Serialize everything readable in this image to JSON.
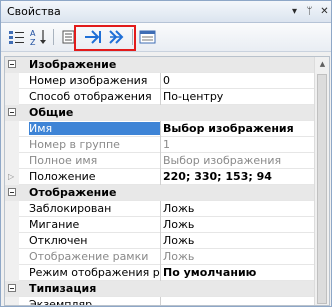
{
  "window": {
    "title": "Свойства"
  },
  "title_buttons": {
    "pin": "▾",
    "pin2": "ᛘ",
    "close": "✕"
  },
  "grid": {
    "rows": [
      {
        "kind": "category",
        "label": "Изображение"
      },
      {
        "kind": "prop",
        "name": "Номер изображения",
        "value": "0"
      },
      {
        "kind": "prop",
        "name": "Способ отображения",
        "value": "По-центру"
      },
      {
        "kind": "category",
        "label": "Общие"
      },
      {
        "kind": "prop",
        "name": "Имя",
        "value": "Выбор изображения",
        "selected": true,
        "value_bold": true
      },
      {
        "kind": "prop",
        "name": "Номер в группе",
        "value": "1",
        "gray": true
      },
      {
        "kind": "prop",
        "name": "Полное имя",
        "value": "Выбор изображения",
        "gray": true
      },
      {
        "kind": "prop",
        "name": "Положение",
        "value": "220; 330; 153; 94",
        "value_bold": true,
        "expand": true
      },
      {
        "kind": "category",
        "label": "Отображение"
      },
      {
        "kind": "prop",
        "name": "Заблокирован",
        "value": "Ложь"
      },
      {
        "kind": "prop",
        "name": "Мигание",
        "value": "Ложь"
      },
      {
        "kind": "prop",
        "name": "Отключен",
        "value": "Ложь"
      },
      {
        "kind": "prop",
        "name": "Отображение рамки",
        "value": "Ложь",
        "gray": true
      },
      {
        "kind": "prop",
        "name": "Режим отображения ра",
        "value": "По умолчанию",
        "value_bold": true
      },
      {
        "kind": "category",
        "label": "Типизация"
      },
      {
        "kind": "prop",
        "name": "Экземпляр",
        "value": ""
      }
    ]
  },
  "colors": {
    "selection": "#3e84d6",
    "highlight_box": "#e21b1b",
    "arrow_icon": "#1f6fd6"
  }
}
